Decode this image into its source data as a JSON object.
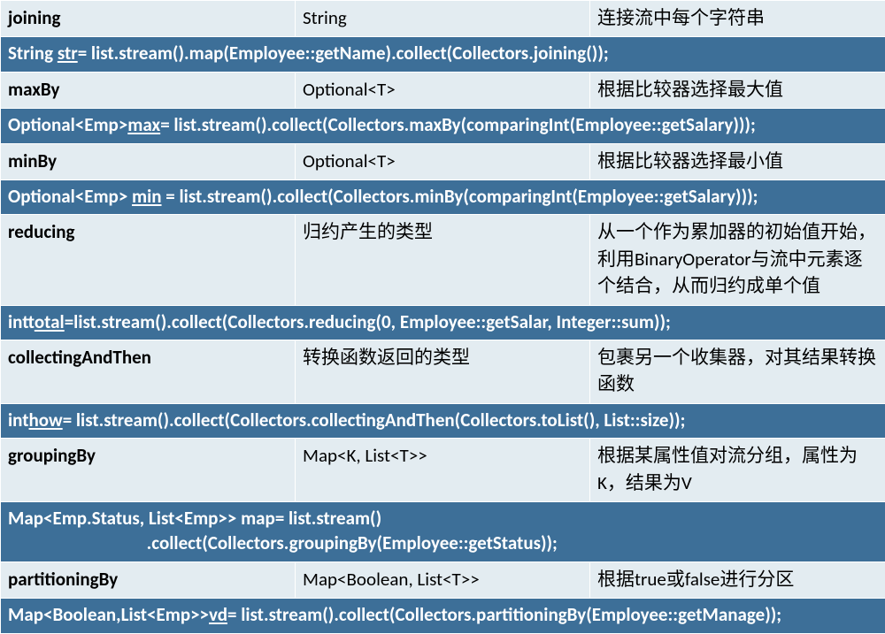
{
  "rows": [
    {
      "kind": "light",
      "name": "joining",
      "ret": "String",
      "desc": "连接流中每个字符串"
    },
    {
      "kind": "code",
      "code": "String <u>str</u>= list.stream().map(Employee::getName).collect(Collectors.joining());"
    },
    {
      "kind": "light",
      "name": "maxBy",
      "ret": "Optional<T>",
      "desc": "根据比较器选择最大值"
    },
    {
      "kind": "code",
      "code": "Optional&lt;Emp&gt;<u>max</u>= list.stream().collect(Collectors.maxBy(comparingInt(Employee::getSalary)));"
    },
    {
      "kind": "light",
      "name": "minBy",
      "ret": "Optional<T>",
      "desc": "根据比较器选择最小值"
    },
    {
      "kind": "code",
      "code": "Optional&lt;Emp&gt; <u>min</u> = list.stream().collect(Collectors.minBy(comparingInt(Employee::getSalary)));"
    },
    {
      "kind": "light",
      "name": "reducing",
      "ret": "归约产生的类型",
      "desc": "从一个作为累加器的初始值开始，利用BinaryOperator与流中元素逐个结合，从而归约成单个值"
    },
    {
      "kind": "code",
      "code": "int<u>total</u>=list.stream().collect(Collectors.reducing(0, Employee::getSalar, Integer::sum));"
    },
    {
      "kind": "light",
      "name": "collectingAndThen",
      "ret": "转换函数返回的类型",
      "desc": "包裹另一个收集器，对其结果转换函数"
    },
    {
      "kind": "code",
      "code": "int<u>how</u>= list.stream().collect(Collectors.collectingAndThen(Collectors.toList(), List::size));"
    },
    {
      "kind": "light",
      "name": "groupingBy",
      "ret": "Map<K, List<T>>",
      "desc": "根据某属性值对流分组，属性为K，结果为V"
    },
    {
      "kind": "code",
      "code": "Map&lt;Emp.Status, List&lt;Emp&gt;&gt; map= list.stream()\n                                 .collect(Collectors.groupingBy(Employee::getStatus));"
    },
    {
      "kind": "light",
      "name": "partitioningBy",
      "ret": "Map<Boolean, List<T>>",
      "desc": "根据true或false进行分区"
    },
    {
      "kind": "code",
      "code": "Map&lt;Boolean,List&lt;Emp&gt;&gt;<u>vd</u>= list.stream().collect(Collectors.partitioningBy(Employee::getManage));"
    }
  ]
}
